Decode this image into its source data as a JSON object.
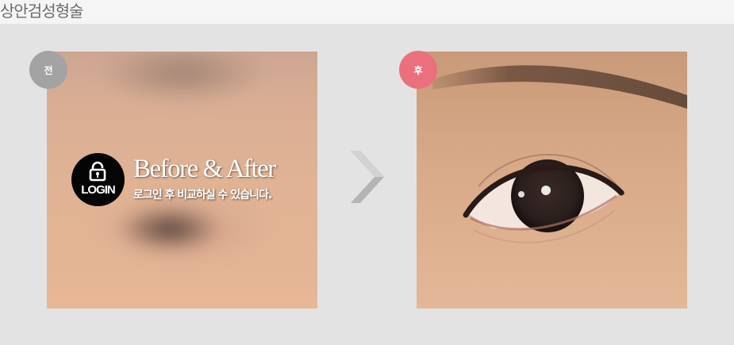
{
  "header": {
    "title": "상안검성형술"
  },
  "before": {
    "badge_label": "전",
    "login": {
      "icon": "lock-icon",
      "button_label": "LOGIN",
      "title": "Before & After",
      "subtitle": "로그인 후 비교하실 수 있습니다."
    }
  },
  "after": {
    "badge_label": "후"
  },
  "colors": {
    "before_badge": "#a3a3a3",
    "after_badge": "#e9707c",
    "background": "#e3e3e3",
    "arrow": "#b0b0b0"
  },
  "icons": {
    "next": "chevron-right-icon"
  }
}
